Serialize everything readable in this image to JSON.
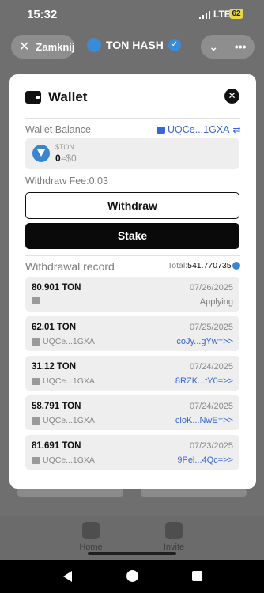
{
  "status_bar": {
    "time": "15:32",
    "network": "LTE",
    "battery": "62"
  },
  "app_bar": {
    "close_label": "Zamknij",
    "title": "TON HASH",
    "close_icon": "close-icon",
    "more_icon": "more-icon",
    "chevron_icon": "chevron-down-icon"
  },
  "bottom_nav": {
    "items": [
      {
        "label": "Home",
        "icon": "home-icon"
      },
      {
        "label": "Invite",
        "icon": "users-icon"
      }
    ]
  },
  "modal": {
    "title": "Wallet",
    "balance_label": "Wallet Balance",
    "address": "UQCe...1GXA",
    "swap_icon": "swap-icon",
    "currency": "$TON",
    "balance_value": "0",
    "balance_usd": "≈$0",
    "fee_label": "Withdraw Fee:0.03",
    "withdraw_label": "Withdraw",
    "stake_label": "Stake",
    "record_label": "Withdrawal record",
    "total_label": "Total:",
    "total_value": "541.770735",
    "records": [
      {
        "amount": "80.901 TON",
        "date": "07/26/2025",
        "source": "",
        "status": "Applying",
        "status_color": "#7d7d7d"
      },
      {
        "amount": "62.01 TON",
        "date": "07/25/2025",
        "source": "UQCe...1GXA",
        "status": "coJy...gYw=>>",
        "status_color": "#3866d6"
      },
      {
        "amount": "31.12 TON",
        "date": "07/24/2025",
        "source": "UQCe...1GXA",
        "status": "8RZK...tY0=>>",
        "status_color": "#3866d6"
      },
      {
        "amount": "58.791 TON",
        "date": "07/24/2025",
        "source": "UQCe...1GXA",
        "status": "cloK...NwE=>>",
        "status_color": "#3866d6"
      },
      {
        "amount": "81.691 TON",
        "date": "07/23/2025",
        "source": "UQCe...1GXA",
        "status": "9Pel...4Qc=>>",
        "status_color": "#3866d6"
      }
    ]
  }
}
